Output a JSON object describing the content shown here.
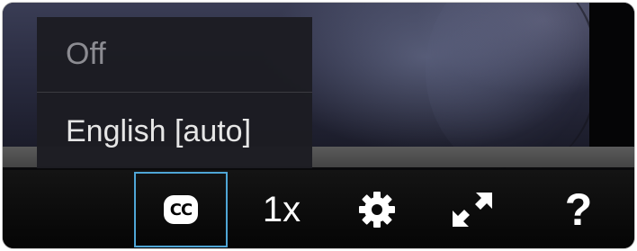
{
  "caption_menu": {
    "options": [
      {
        "label": "Off",
        "selected": false
      },
      {
        "label": "English [auto]",
        "selected": true
      }
    ]
  },
  "controls": {
    "cc": {
      "label": "CC",
      "icon": "closed-captions-icon",
      "active": true
    },
    "speed": {
      "label": "1x"
    },
    "settings": {
      "icon": "gear-icon"
    },
    "fullscreen": {
      "icon": "expand-arrows-icon"
    },
    "help": {
      "label": "?",
      "icon": "question-mark-icon"
    }
  },
  "colors": {
    "focus_outline": "#4fa6d6",
    "control_bar": "#0b0b0b",
    "menu_background": "#1c1c22",
    "menu_text_inactive": "#8c8c92",
    "menu_text_active": "#e6e6e6",
    "progress_track": "#4f4f4f"
  }
}
